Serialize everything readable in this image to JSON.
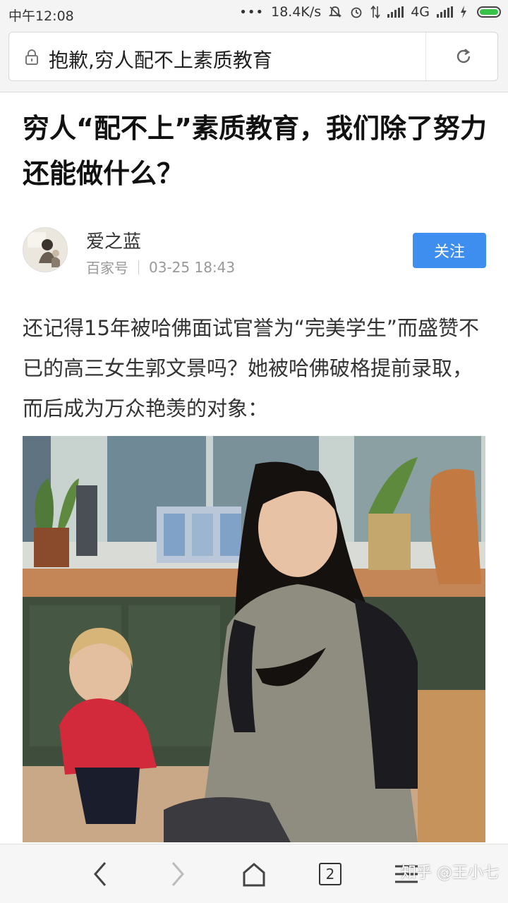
{
  "status_bar": {
    "time": "中午12:08",
    "speed": "18.4K/s",
    "network": "4G",
    "colors": {
      "battery": "#38c24a"
    }
  },
  "url_bar": {
    "text": "抱歉,穷人配不上素质教育"
  },
  "article": {
    "title": "穷人“配不上”素质教育，我们除了努力还能做什么？",
    "author": {
      "name": "爱之蓝",
      "source": "百家号",
      "time": "03-25 18:43"
    },
    "follow_label": "关注",
    "paragraph": "还记得15年被哈佛面试官誉为“完美学生”而盛赞不已的高三女生郭文景吗？她被哈佛破格提前录取，而后成为万众艳羡的对象："
  },
  "bottom_nav": {
    "tab_count": "2",
    "watermark": "知乎 @王小七"
  },
  "colors": {
    "accent": "#3e8ef0",
    "title": "#111111",
    "body": "#333333",
    "meta": "#999999"
  },
  "icons": [
    "lock-icon",
    "reload-icon",
    "back-icon",
    "forward-icon",
    "home-icon",
    "tabs-icon",
    "menu-icon"
  ]
}
